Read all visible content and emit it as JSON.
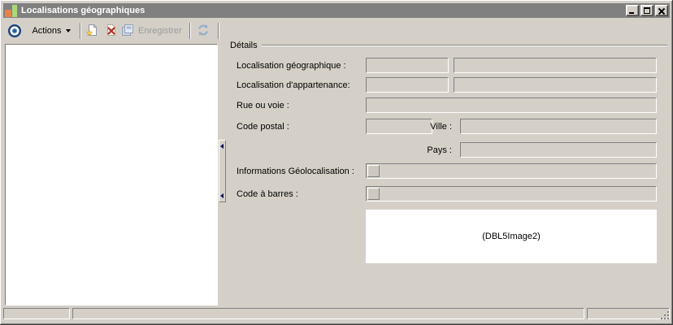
{
  "window": {
    "title": "Localisations géographiques"
  },
  "toolbar": {
    "actions": {
      "label": "Actions"
    },
    "save": {
      "label": "Enregistrer",
      "enabled": false
    }
  },
  "details": {
    "legend": "Détails",
    "rows": [
      {
        "label": "Localisation géographique :",
        "code": "",
        "name": ""
      },
      {
        "label": "Localisation d'appartenance:",
        "code": "",
        "name": ""
      },
      {
        "label": "Rue ou voie :",
        "value": ""
      },
      {
        "label": "Code postal :",
        "value": "",
        "city": {
          "label": "Ville :",
          "value": ""
        }
      },
      {
        "label": "Pays :",
        "value": ""
      },
      {
        "label": "Informations Géolocalisation :",
        "value": ""
      },
      {
        "label": "Code à barres :",
        "value": ""
      }
    ],
    "image_placeholder": "(DBL5Image2)"
  },
  "status_bar": {
    "panels": [
      "",
      "",
      ""
    ]
  },
  "icons": {
    "app_icon": "mini-bar-chart",
    "window_controls": [
      "minimize-icon",
      "maximize-icon",
      "close-icon"
    ],
    "toolbar": [
      "bullseye-icon",
      "new-item-icon",
      "delete-icon",
      "save-icon",
      "refresh-icon"
    ],
    "splitter": "collapse-left-arrows",
    "status": "resize-grip"
  },
  "colors": {
    "window_bg": "#d4d0c8",
    "titlebar_bg": "#808080",
    "titlebar_text": "#ffffff",
    "field_bg": "#d4d0c8",
    "list_bg": "#ffffff",
    "disabled_text": "#9b9b9b",
    "accent_blue": "#2a62a8",
    "icon_red": "#b23028",
    "icon_yellow": "#f2d35c",
    "app_icon_orange": "#e8824a",
    "app_icon_green": "#aad878"
  }
}
